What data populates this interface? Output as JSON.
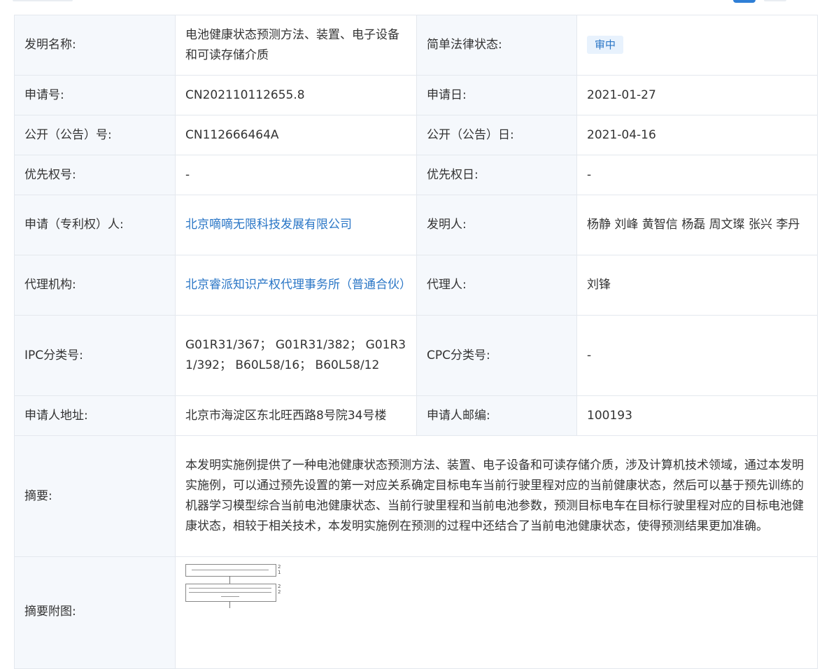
{
  "patent": {
    "title": {
      "label": "发明名称:",
      "value": "电池健康状态预测方法、装置、电子设备和可读存储介质"
    },
    "legal_status": {
      "label": "简单法律状态:",
      "value": "审中"
    },
    "application_no": {
      "label": "申请号:",
      "value": "CN202110112655.8"
    },
    "application_date": {
      "label": "申请日:",
      "value": "2021-01-27"
    },
    "publication_no": {
      "label": "公开（公告）号:",
      "value": "CN112666464A"
    },
    "publication_date": {
      "label": "公开（公告）日:",
      "value": "2021-04-16"
    },
    "priority_no": {
      "label": "优先权号:",
      "value": "-"
    },
    "priority_date": {
      "label": "优先权日:",
      "value": "-"
    },
    "applicant": {
      "label": "申请（专利权）人:",
      "value": "北京嘀嘀无限科技发展有限公司"
    },
    "inventors": {
      "label": "发明人:",
      "value": "杨静 刘峰 黄智信 杨磊 周文璨 张兴 李丹"
    },
    "agency": {
      "label": "代理机构:",
      "value": "北京睿派知识产权代理事务所（普通合伙）"
    },
    "agent": {
      "label": "代理人:",
      "value": "刘锋"
    },
    "ipc": {
      "label": "IPC分类号:",
      "value": "G01R31/367； G01R31/382； G01R31/392； B60L58/16； B60L58/12"
    },
    "cpc": {
      "label": "CPC分类号:",
      "value": "-"
    },
    "address": {
      "label": "申请人地址:",
      "value": "北京市海淀区东北旺西路8号院34号楼"
    },
    "postcode": {
      "label": "申请人邮编:",
      "value": "100193"
    },
    "abstract": {
      "label": "摘要:",
      "value": "本发明实施例提供了一种电池健康状态预测方法、装置、电子设备和可读存储介质，涉及计算机技术领域，通过本发明实施例，可以通过预先设置的第一对应关系确定目标电车当前行驶里程对应的当前健康状态，然后可以基于预先训练的机器学习模型综合当前电池健康状态、当前行驶里程和当前电池参数，预测目标电车在目标行驶里程对应的目标电池健康状态，相较于相关技术，本发明实施例在预测的过程中还结合了当前电池健康状态，使得预测结果更加准确。"
    },
    "abstract_figure": {
      "label": "摘要附图:",
      "step1": "21",
      "step2": "22"
    }
  },
  "colors": {
    "label_bg": "#f5f8fc",
    "border": "#e4e8ee",
    "link": "#2a76c6",
    "badge_bg": "#e8f2fd"
  }
}
